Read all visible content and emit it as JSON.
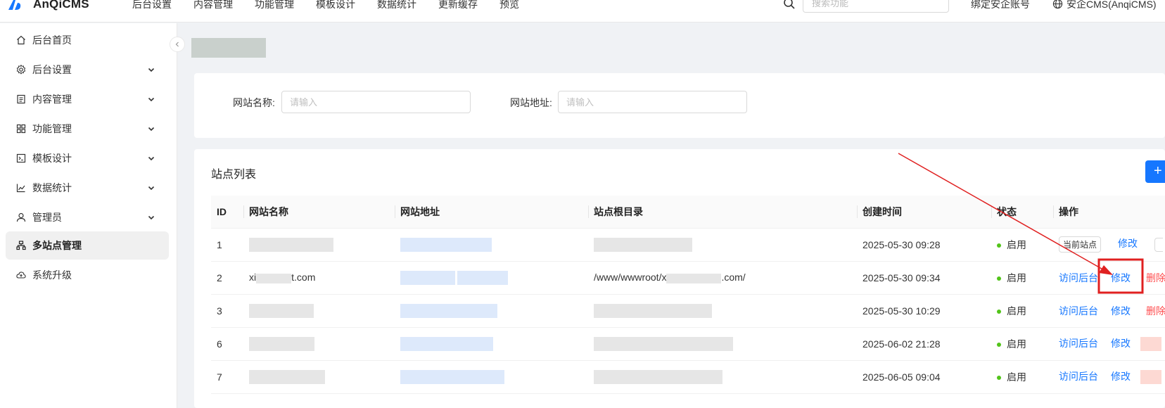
{
  "header": {
    "brand": "AnQiCMS",
    "nav": [
      "后台设置",
      "内容管理",
      "功能管理",
      "模板设计",
      "数据统计",
      "更新缓存",
      "预览"
    ],
    "search_placeholder": "搜索功能",
    "bind_account": "绑定安企账号",
    "site_name": "安企CMS(AnqiCMS)",
    "icons": [
      "logo-icon",
      "search-icon",
      "globe-icon"
    ]
  },
  "sidebar": {
    "items": [
      {
        "label": "后台首页",
        "icon": "home-icon",
        "expandable": false
      },
      {
        "label": "后台设置",
        "icon": "gear-icon",
        "expandable": true
      },
      {
        "label": "内容管理",
        "icon": "document-icon",
        "expandable": true
      },
      {
        "label": "功能管理",
        "icon": "grid-icon",
        "expandable": true
      },
      {
        "label": "模板设计",
        "icon": "terminal-icon",
        "expandable": true
      },
      {
        "label": "数据统计",
        "icon": "chart-icon",
        "expandable": true
      },
      {
        "label": "管理员",
        "icon": "user-icon",
        "expandable": true
      },
      {
        "label": "多站点管理",
        "icon": "sitemap-icon",
        "expandable": false,
        "active": true
      },
      {
        "label": "系统升级",
        "icon": "cloud-icon",
        "expandable": false
      }
    ]
  },
  "filters": {
    "name_label": "网站名称:",
    "name_placeholder": "请输入",
    "url_label": "网站地址:",
    "url_placeholder": "请输入"
  },
  "list": {
    "title": "站点列表",
    "add_label": "+",
    "columns": [
      "ID",
      "网站名称",
      "网站地址",
      "站点根目录",
      "创建时间",
      "状态",
      "操作"
    ],
    "rows": [
      {
        "id": "1",
        "name": "",
        "root": "",
        "created": "2025-05-30 09:28",
        "status": "启用",
        "first_action": "当前站点",
        "edit": "修改",
        "delete": ""
      },
      {
        "id": "2",
        "name": "xi",
        "name_suffix": "t.com",
        "root": "/www/wwwroot/x",
        "root_suffix": ".com/",
        "created": "2025-05-30 09:34",
        "status": "启用",
        "first_action": "访问后台",
        "edit": "修改",
        "delete": "删除"
      },
      {
        "id": "3",
        "name": "",
        "root": "",
        "created": "2025-05-30 10:29",
        "status": "启用",
        "first_action": "访问后台",
        "edit": "修改",
        "delete": "删除"
      },
      {
        "id": "6",
        "name": "",
        "root": "",
        "created": "2025-06-02 21:28",
        "status": "启用",
        "first_action": "访问后台",
        "edit": "修改",
        "delete": ""
      },
      {
        "id": "7",
        "name": "",
        "root": "",
        "created": "2025-06-05 09:04",
        "status": "启用",
        "first_action": "访问后台",
        "edit": "修改",
        "delete": ""
      }
    ]
  },
  "colors": {
    "primary": "#1677ff",
    "success": "#52c41a",
    "danger": "#ff4d4f",
    "annotation": "#e02020"
  }
}
